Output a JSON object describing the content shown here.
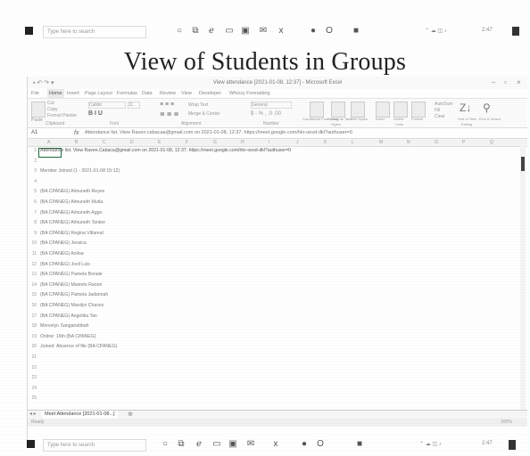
{
  "top_taskbar": {
    "search_placeholder": "Type here to search",
    "clock": "2:47"
  },
  "page_title": "View of Students in Groups",
  "excel": {
    "window_title": "View attendance [2021-01-08, 12:37] - Microsoft Excel",
    "tabs": [
      "File",
      "Home",
      "Insert",
      "Page Layout",
      "Formulas",
      "Data",
      "Review",
      "View",
      "Developer",
      "Whizzy Formatting"
    ],
    "ribbon": {
      "paste": "Paste",
      "cut": "Cut",
      "copy": "Copy",
      "format_painter": "Format Painter",
      "clipboard_group": "Clipboard",
      "font_name": "Calibri",
      "font_size": "11",
      "font_group": "Font",
      "wrap_text": "Wrap Text",
      "merge_center": "Merge & Center",
      "alignment_group": "Alignment",
      "number_format": "General",
      "number_group": "Number",
      "conditional_formatting": "Conditional Formatting",
      "format_as_table": "Format as Table",
      "cell_styles": "Cell Styles",
      "styles_group": "Styles",
      "insert": "Insert",
      "delete": "Delete",
      "format": "Format",
      "cells_group": "Cells",
      "autosum": "AutoSum",
      "fill": "Fill",
      "clear": "Clear",
      "sort_filter": "Sort & Filter",
      "find_select": "Find & Select",
      "editing_group": "Editing"
    },
    "name_box": "A1",
    "formula": "Attendance list. View Raven.cabacaa@gmail.com on 2021-01-08, 12:37. https://meet.google.com/hkr-oesd-dkl?authuser=0",
    "columns": [
      "A",
      "B",
      "C",
      "D",
      "E",
      "F",
      "G",
      "H",
      "I",
      "J",
      "K",
      "L",
      "M",
      "N",
      "O",
      "P",
      "Q"
    ],
    "rows": [
      {
        "n": "1",
        "text": "Attendance list. View Raven.Cabaca@gmail.com on 2021-01-08, 12:37. https://meet.google.com/hkr-oesd-dkl?authuser=0"
      },
      {
        "n": "2",
        "text": ""
      },
      {
        "n": "3",
        "text": "Member Joined (1 - 2021-01-08 15:12)"
      },
      {
        "n": "4",
        "text": ""
      },
      {
        "n": "5",
        "text": "(BA CPANEG) Almuneth Reyes"
      },
      {
        "n": "6",
        "text": "(BA CPANEG) Almuneth Mutla"
      },
      {
        "n": "7",
        "text": "(BA CPANEG) Almuneth Aggo"
      },
      {
        "n": "8",
        "text": "(BA CPANEG) Almuneth Tantee"
      },
      {
        "n": "9",
        "text": "(BA CPANEG) Regina Villareal"
      },
      {
        "n": "10",
        "text": "(BA CPANEG) Jessica"
      },
      {
        "n": "11",
        "text": "(BA CPANEG) Aniloa"
      },
      {
        "n": "12",
        "text": "(BA CPANEG) Jovil Luis"
      },
      {
        "n": "13",
        "text": "(BA CPANEG) Pamela Bonale"
      },
      {
        "n": "14",
        "text": "(BA CPANEG) Mavieto Ranon"
      },
      {
        "n": "15",
        "text": "(BA CPANEG) Pamela Jadannah"
      },
      {
        "n": "16",
        "text": "(BA CPANEG) Manilyn Chavez"
      },
      {
        "n": "17",
        "text": "(BA CPANEG) Angelika Tan"
      },
      {
        "n": "18",
        "text": "Mervelyn Sanganatibah"
      },
      {
        "n": "19",
        "text": "Online: 16th (BA CPANEG)"
      },
      {
        "n": "20",
        "text": "Joined: Absence of file (BA CPANEG)"
      },
      {
        "n": "21",
        "text": ""
      },
      {
        "n": "22",
        "text": ""
      },
      {
        "n": "23",
        "text": ""
      },
      {
        "n": "24",
        "text": ""
      },
      {
        "n": "25",
        "text": ""
      }
    ],
    "sheet_tab": "Meet Attendance [2021-01-08...]",
    "status_ready": "Ready",
    "zoom": "100%"
  },
  "bottom_taskbar": {
    "search_placeholder": "Type here to search",
    "clock": "2:47"
  }
}
